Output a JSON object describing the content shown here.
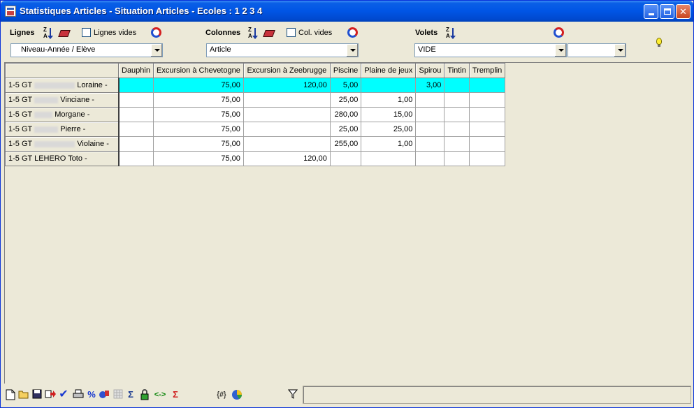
{
  "window": {
    "title": "Statistiques Articles - Situation Articles - Ecoles : 1 2 3 4"
  },
  "toolbar": {
    "lignes": {
      "label": "Lignes",
      "sort_az": [
        "Z",
        "A"
      ],
      "empty_label": "Lignes vides",
      "select_value": "Niveau-Année / Elève"
    },
    "colonnes": {
      "label": "Colonnes",
      "sort_az": [
        "Z",
        "A"
      ],
      "empty_label": "Col. vides",
      "select_value": "Article"
    },
    "volets": {
      "label": "Volets",
      "sort_az": [
        "Z",
        "A"
      ],
      "select_value": "VIDE",
      "select2_value": ""
    }
  },
  "grid": {
    "columns": [
      "Dauphin",
      "Excursion à Chevetogne",
      "Excursion à Zeebrugge",
      "Piscine",
      "Plaine de jeux",
      "Spirou",
      "Tintin",
      "Tremplin"
    ],
    "rows": [
      {
        "prefix": "1-5 GT",
        "name": "Loraine -",
        "blur": "l",
        "values": [
          "",
          "75,00",
          "120,00",
          "5,00",
          "",
          "3,00",
          "",
          ""
        ],
        "selected": true
      },
      {
        "prefix": "1-5 GT",
        "name": "Vinciane -",
        "blur": "m",
        "values": [
          "",
          "75,00",
          "",
          "25,00",
          "1,00",
          "",
          "",
          ""
        ],
        "selected": false
      },
      {
        "prefix": "1-5 GT",
        "name": "Morgane -",
        "blur": "s",
        "values": [
          "",
          "75,00",
          "",
          "280,00",
          "15,00",
          "",
          "",
          ""
        ],
        "selected": false
      },
      {
        "prefix": "1-5 GT",
        "name": "Pierre -",
        "blur": "m",
        "values": [
          "",
          "75,00",
          "",
          "25,00",
          "25,00",
          "",
          "",
          ""
        ],
        "selected": false
      },
      {
        "prefix": "1-5 GT",
        "name": "Violaine -",
        "blur": "l",
        "values": [
          "",
          "75,00",
          "",
          "255,00",
          "1,00",
          "",
          "",
          ""
        ],
        "selected": false
      },
      {
        "prefix": "1-5 GT LEHERO",
        "name": "Toto -",
        "blur": "",
        "values": [
          "",
          "75,00",
          "120,00",
          "",
          "",
          "",
          "",
          ""
        ],
        "selected": false
      }
    ]
  },
  "bottom_toolbar": {
    "icons": [
      "new-icon",
      "open-folder-icon",
      "save-icon",
      "export-icon",
      "check-icon",
      "print-icon",
      "percent-icon",
      "chart-icon",
      "grid-icon",
      "sum-icon",
      "lock-icon",
      "swap-icon",
      "sum-red-icon",
      "format-icon",
      "pie-icon",
      "filter-icon"
    ],
    "percent_glyph": "%",
    "sigma_glyph": "Σ",
    "swap_glyph": "<->",
    "format_glyph": "{#}"
  }
}
